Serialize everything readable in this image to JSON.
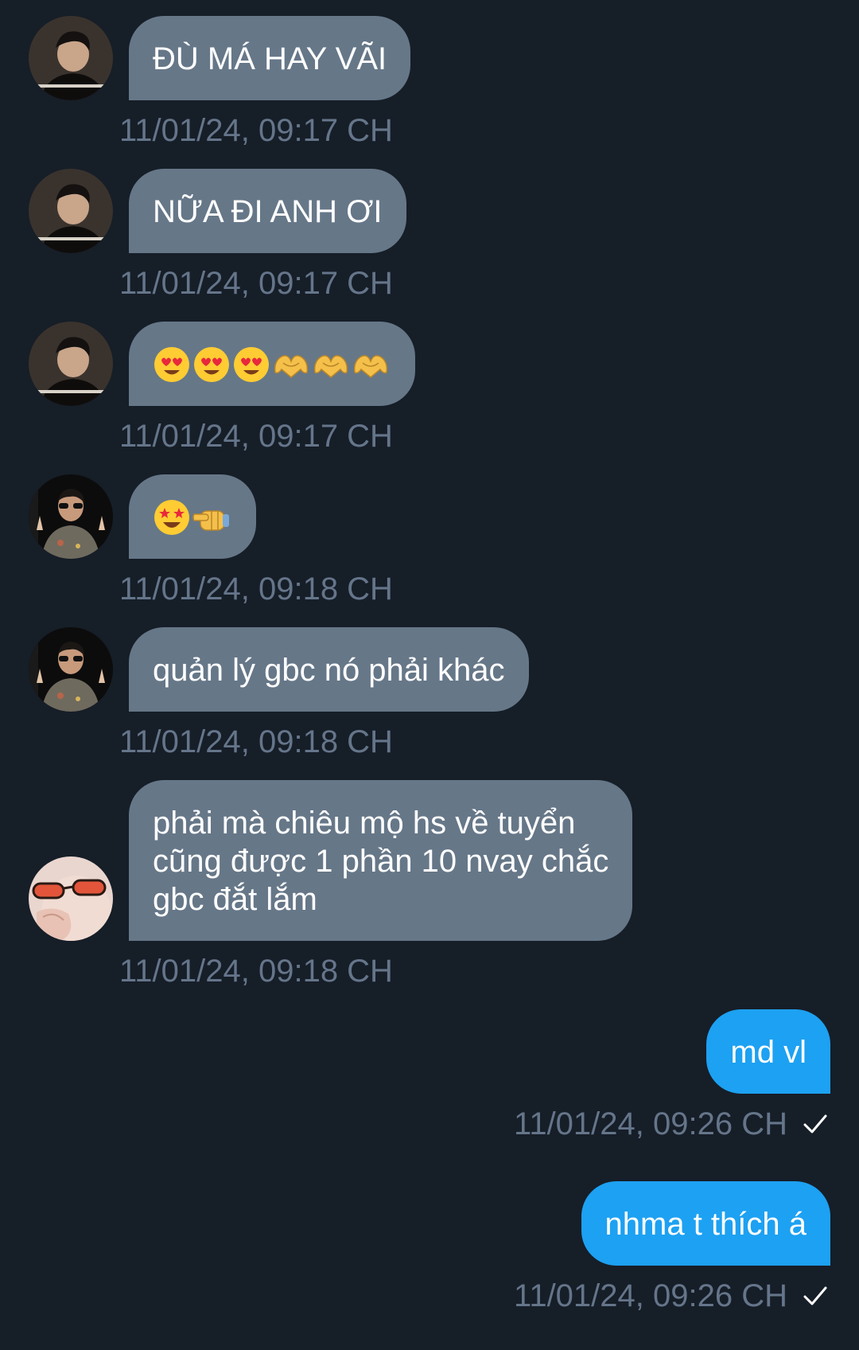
{
  "colors": {
    "background": "#161e28",
    "incoming_bubble": "#667788",
    "outgoing_bubble": "#1da1f2",
    "timestamp": "#65758a"
  },
  "messages": [
    {
      "direction": "incoming",
      "avatar": "avatar-dark-hair-man",
      "text": "ĐÙ MÁ HAY VÃI",
      "time": "11/01/24, 09:17 CH"
    },
    {
      "direction": "incoming",
      "avatar": "avatar-dark-hair-man",
      "text": "NỮA ĐI ANH ƠI",
      "time": "11/01/24, 09:17 CH"
    },
    {
      "direction": "incoming",
      "avatar": "avatar-dark-hair-man",
      "emojis": [
        "heart-eyes-emoji",
        "heart-eyes-emoji",
        "heart-eyes-emoji",
        "heart-hands-emoji",
        "heart-hands-emoji",
        "heart-hands-emoji"
      ],
      "time": "11/01/24, 09:17 CH"
    },
    {
      "direction": "incoming",
      "avatar": "avatar-sunglasses-peace",
      "emojis": [
        "star-struck-emoji",
        "pointing-fist-emoji"
      ],
      "time": "11/01/24, 09:18 CH"
    },
    {
      "direction": "incoming",
      "avatar": "avatar-sunglasses-peace",
      "text": "quản lý gbc nó phải khác",
      "time": "11/01/24, 09:18 CH"
    },
    {
      "direction": "incoming",
      "avatar": "avatar-orange-glasses",
      "lines": [
        "phải mà chiêu mộ hs về tuyển",
        "cũng được 1 phần 10 nvay chắc",
        "gbc đắt lắm"
      ],
      "time": "11/01/24, 09:18 CH"
    },
    {
      "direction": "outgoing",
      "text": "md vl",
      "time": "11/01/24, 09:26 CH",
      "status_icon": "sent-check-icon"
    },
    {
      "direction": "outgoing",
      "text": "nhma t thích á",
      "time": "11/01/24, 09:26 CH",
      "status_icon": "sent-check-icon"
    }
  ]
}
